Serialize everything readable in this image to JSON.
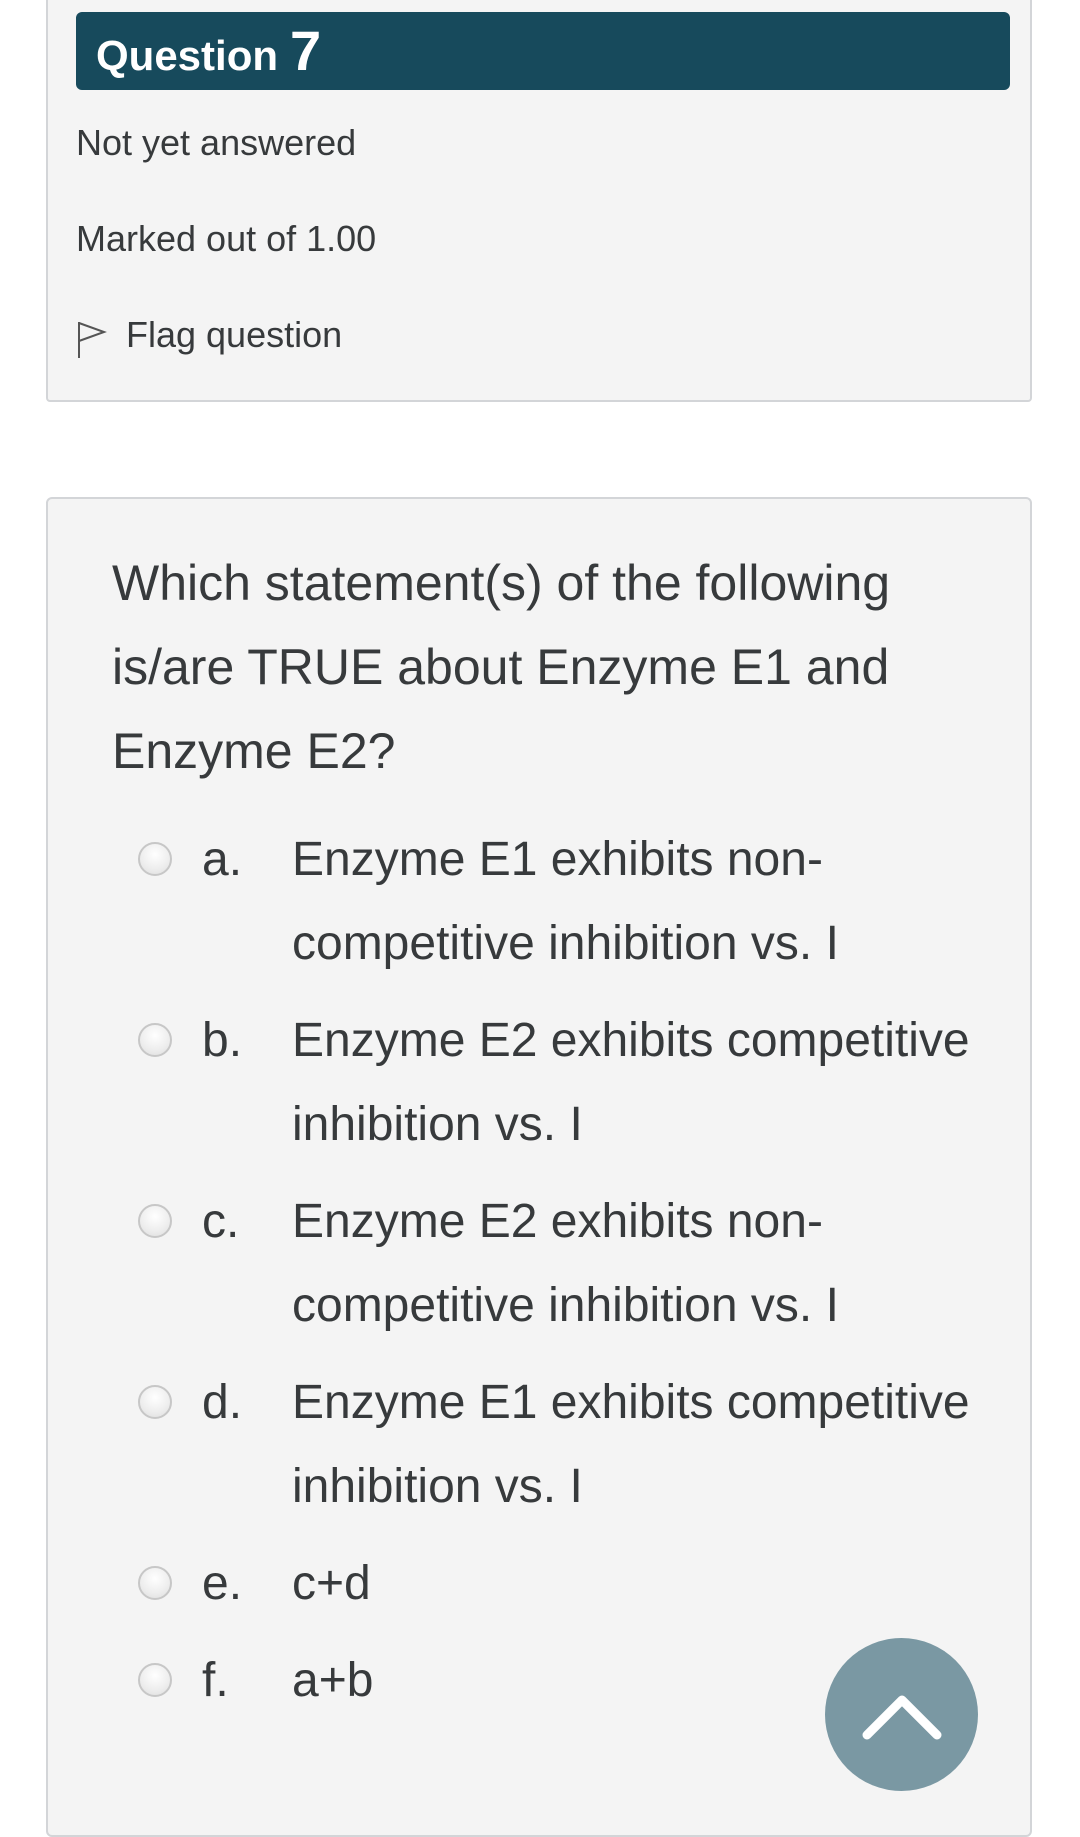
{
  "question_info": {
    "label": "Question",
    "number": "7",
    "state": "Not yet answered",
    "grade": "Marked out of 1.00",
    "flag_label": "Flag question"
  },
  "question": {
    "text": "Which statement(s) of the following is/are TRUE about Enzyme E1 and Enzyme E2?",
    "answers": [
      {
        "letter": "a.",
        "text": "Enzyme E1 exhibits non-competitive inhibition vs. I"
      },
      {
        "letter": "b.",
        "text": "Enzyme E2 exhibits competitive inhibition vs. I"
      },
      {
        "letter": "c.",
        "text": "Enzyme E2 exhibits non-competitive inhibition vs. I"
      },
      {
        "letter": "d.",
        "text": "Enzyme E1 exhibits competitive inhibition vs. I"
      },
      {
        "letter": "e.",
        "text": "c+d"
      },
      {
        "letter": "f.",
        "text": "a+b"
      }
    ]
  },
  "icons": {
    "flag": "flag-outline-icon",
    "scroll_top": "chevron-up-icon"
  },
  "colors": {
    "header_bg": "#174a5c",
    "scroll_button": "#7a98a3",
    "panel_bg": "#f4f4f4"
  }
}
